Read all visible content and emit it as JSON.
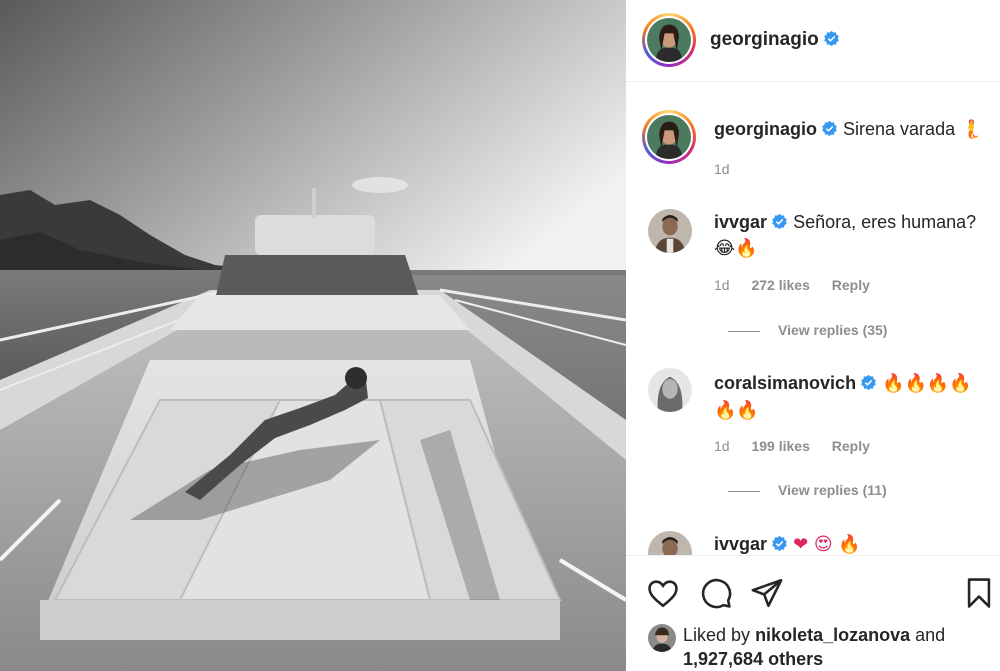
{
  "post": {
    "username": "georginagio",
    "verified": true,
    "image_alt": "Black and white photo of a woman lying on the sunbed of a yacht at sea"
  },
  "caption": {
    "username": "georginagio",
    "text": "Sirena varada",
    "emoji": "🧜",
    "time": "1d"
  },
  "comments": [
    {
      "username": "ivvgar",
      "text": "Señora, eres humana?",
      "emoji": "😂🔥",
      "time": "1d",
      "likes": "272 likes",
      "reply_label": "Reply",
      "view_replies": "View replies (35)"
    },
    {
      "username": "coralsimanovich",
      "text": "",
      "emoji": "🔥🔥🔥🔥🔥🔥",
      "time": "1d",
      "likes": "199 likes",
      "reply_label": "Reply",
      "view_replies": "View replies (11)"
    },
    {
      "username": "ivvgar",
      "text": "",
      "emoji": "❤ 😍 🔥"
    }
  ],
  "actions": {
    "icons": [
      "heart-icon",
      "comment-icon",
      "share-icon",
      "bookmark-icon"
    ],
    "liked_prefix": "Liked by",
    "liked_user": "nikoleta_lozanova",
    "liked_and": "and",
    "liked_others": "1,927,684 others"
  },
  "colors": {
    "verified": "#3897f0",
    "muted_text": "#8e8e8e",
    "text": "#262626"
  }
}
